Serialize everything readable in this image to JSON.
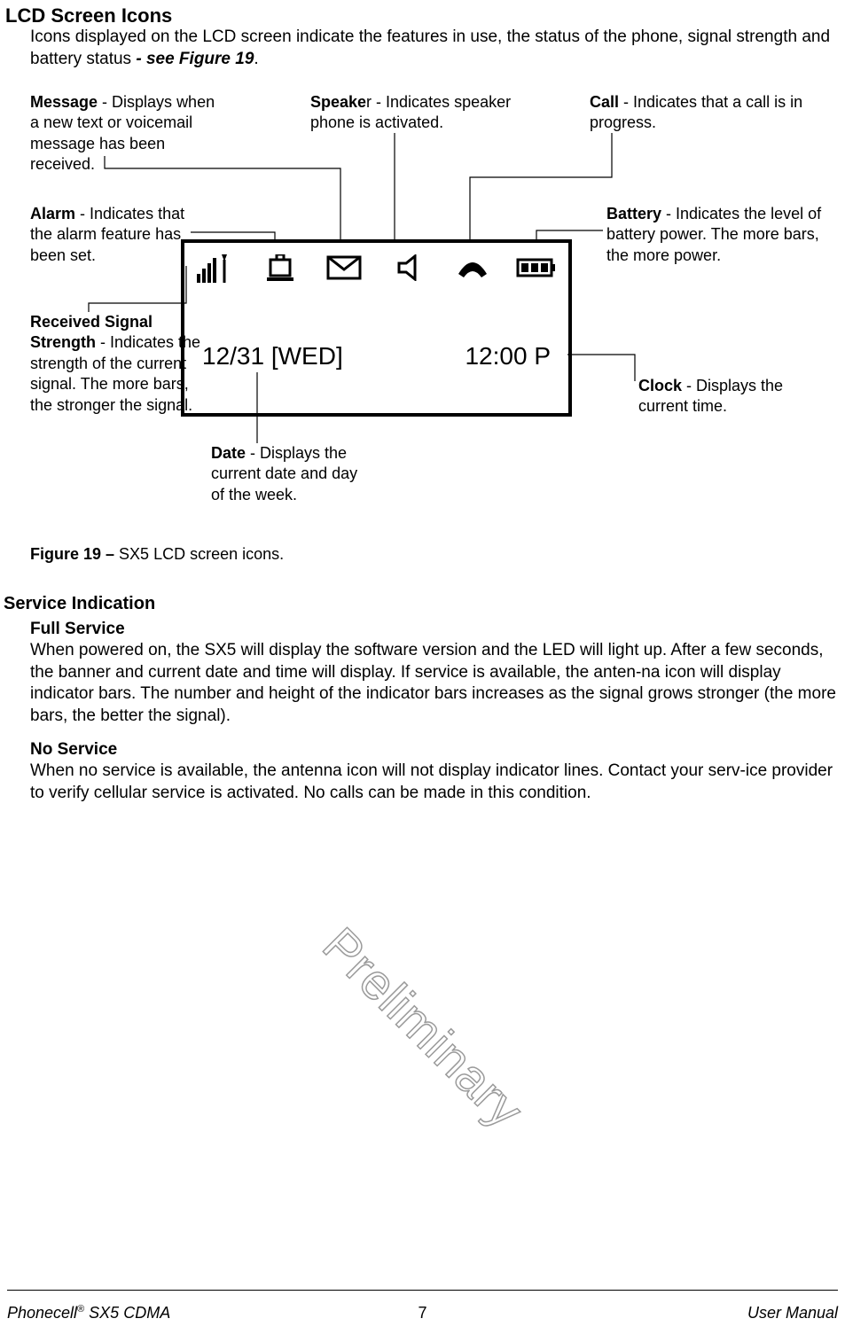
{
  "heading1": "LCD Screen Icons",
  "intro": "Icons displayed on the LCD screen indicate the features in use, the status of the phone, signal strength and battery status ",
  "intro_ref": "- see Figure 19",
  "intro_ref_suffix": ".",
  "callouts": {
    "message": {
      "bold": "Message",
      "text": " - Displays when a new text or voicemail message has been received."
    },
    "speaker": {
      "bold": "Speake",
      "text": "r - Indicates speaker phone is activated."
    },
    "call": {
      "bold": "Call",
      "text": " - Indicates that a call is in progress."
    },
    "alarm": {
      "bold": "Alarm",
      "text": " - Indicates that the alarm feature has been set."
    },
    "battery": {
      "bold": "Battery",
      "text": " - Indicates the level of battery power. The more bars, the more power."
    },
    "signal": {
      "bold": "Received Signal Strength",
      "text": " - Indicates the strength of the current signal. The more bars, the stronger the signal."
    },
    "date": {
      "bold": "Date",
      "text": " - Displays the current date and day of the week."
    },
    "clock": {
      "bold": "Clock",
      "text": " - Displays the current time."
    }
  },
  "lcd": {
    "date_line": "12/31  [WED]",
    "time_line": "12:00 P"
  },
  "caption": {
    "bold": "Figure 19 – ",
    "text": "SX5 LCD screen icons."
  },
  "heading2": "Service Indication",
  "subsections": {
    "full": {
      "heading": "Full Service",
      "body": "When powered on, the SX5 will display the software version and the LED will light up.  After a few seconds, the banner and current date and time will display.  If service is available, the anten-na icon will display indicator bars.  The number and height of the indicator bars increases as the signal grows stronger (the more bars, the better the signal)."
    },
    "no": {
      "heading": "No Service",
      "body": "When no service is available, the antenna icon will not display indicator lines. Contact your serv-ice provider to verify cellular service is activated. No calls can be made in this condition."
    }
  },
  "watermark": "Preliminary",
  "footer": {
    "left_prefix": "Phonecell",
    "left_reg": "®",
    "left_suffix": " SX5 CDMA",
    "center": "7",
    "right": "User Manual"
  }
}
